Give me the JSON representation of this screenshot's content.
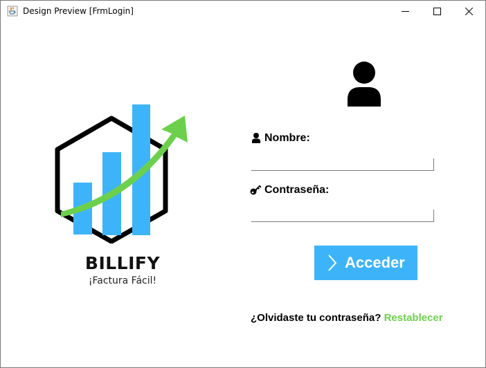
{
  "window": {
    "title": "Design Preview [FrmLogin]",
    "icons": {
      "app": "java-cup-icon",
      "minimize": "minimize-icon",
      "maximize": "maximize-icon",
      "close": "close-icon"
    }
  },
  "brand": {
    "name": "BILLIFY",
    "slogan": "¡Factura Fácil!",
    "colors": {
      "bars": "#3db4f9",
      "arrow": "#6cd04c",
      "hexagon": "#000000"
    }
  },
  "login": {
    "avatar_icon": "user-avatar-icon",
    "username_label": "Nombre:",
    "username_icon": "user-icon",
    "username_value": "",
    "password_label": "Contraseña:",
    "password_icon": "key-icon",
    "password_value": "",
    "submit_label": "Acceder",
    "submit_icon": "chevron-right-icon",
    "submit_color": "#3db4f9",
    "forgot_text": "¿Olvidaste tu contraseña?",
    "reset_link": "Restablecer",
    "reset_color": "#6cd04c"
  }
}
